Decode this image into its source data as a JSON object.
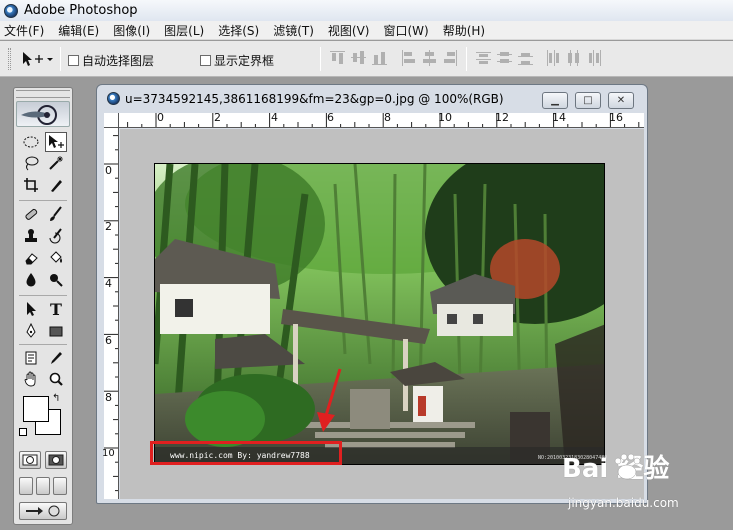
{
  "app": {
    "title": "Adobe Photoshop"
  },
  "menu": [
    "文件(F)",
    "编辑(E)",
    "图像(I)",
    "图层(L)",
    "选择(S)",
    "滤镜(T)",
    "视图(V)",
    "窗口(W)",
    "帮助(H)"
  ],
  "options": {
    "auto_select_label": "自动选择图层",
    "auto_select_checked": false,
    "show_bounds_label": "显示定界框",
    "show_bounds_checked": false
  },
  "document": {
    "title": "u=3734592145,3861168199&fm=23&gp=0.jpg @ 100%(RGB)",
    "ruler_top": [
      "0",
      "2",
      "4",
      "6",
      "8",
      "10",
      "12",
      "14",
      "16"
    ],
    "ruler_left": [
      "0",
      "2",
      "4",
      "6",
      "8",
      "10"
    ],
    "image_watermark": "www.nipic.com      By: yandrew7788",
    "image_corner_text": "NO:20100323183028047489"
  },
  "overlay": {
    "logo": "Bai 经验",
    "url": "jingyan.baidu.com"
  },
  "colors": {
    "highlight_box": "#e02020",
    "arrow": "#e02020",
    "foreground": "#ffffff",
    "background": "#ffffff"
  },
  "icons": [
    "move-icon",
    "marquee-icon",
    "lasso-icon",
    "magic-wand-icon",
    "crop-icon",
    "slice-icon",
    "healing-brush-icon",
    "brush-icon",
    "stamp-icon",
    "history-brush-icon",
    "eraser-icon",
    "paint-bucket-icon",
    "blur-icon",
    "dodge-icon",
    "path-select-icon",
    "type-icon",
    "pen-icon",
    "shape-icon",
    "notes-icon",
    "eyedropper-icon",
    "hand-icon",
    "zoom-icon"
  ]
}
